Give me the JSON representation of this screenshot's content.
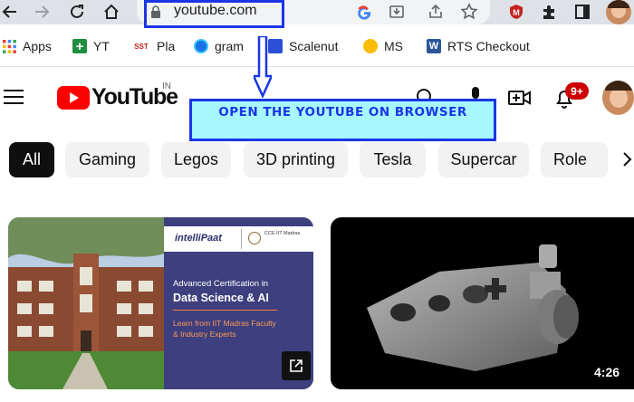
{
  "browser": {
    "url": "youtube.com",
    "bookmarks": [
      {
        "label": "Apps",
        "icon": "apps-grid-icon"
      },
      {
        "label": "YT",
        "icon": "plus-green-icon"
      },
      {
        "label": "Pla",
        "icon": "sst-icon",
        "icon_text": "SST"
      },
      {
        "label": "gram",
        "icon": "edge-icon"
      },
      {
        "label": "Scalenut",
        "icon": "scalenut-icon"
      },
      {
        "label": "MS",
        "icon": "bulb-icon"
      },
      {
        "label": "RTS Checkout",
        "icon": "word-icon"
      }
    ]
  },
  "youtube": {
    "logo_text": "YouTube",
    "country_code": "IN",
    "notification_count": "9+",
    "chips": [
      "All",
      "Gaming",
      "Legos",
      "3D printing",
      "Tesla",
      "Supercar",
      "Role"
    ],
    "videos": [
      {
        "brand": "intelliPaat",
        "partner": "CCE IIT Madras",
        "cert_line": "Advanced Certification in",
        "topic": "Data Science & AI",
        "subline1": "Learn from IIT Madras Faculty",
        "subline2": "& Industry Experts"
      },
      {
        "duration": "4:26"
      }
    ]
  },
  "annotation": {
    "text": "OPEN THE YOUTUBE ON BROWSER"
  },
  "colors": {
    "annotation_border": "#1a35e6",
    "annotation_fill": "#a6f7ff",
    "yt_red": "#ff0000"
  }
}
